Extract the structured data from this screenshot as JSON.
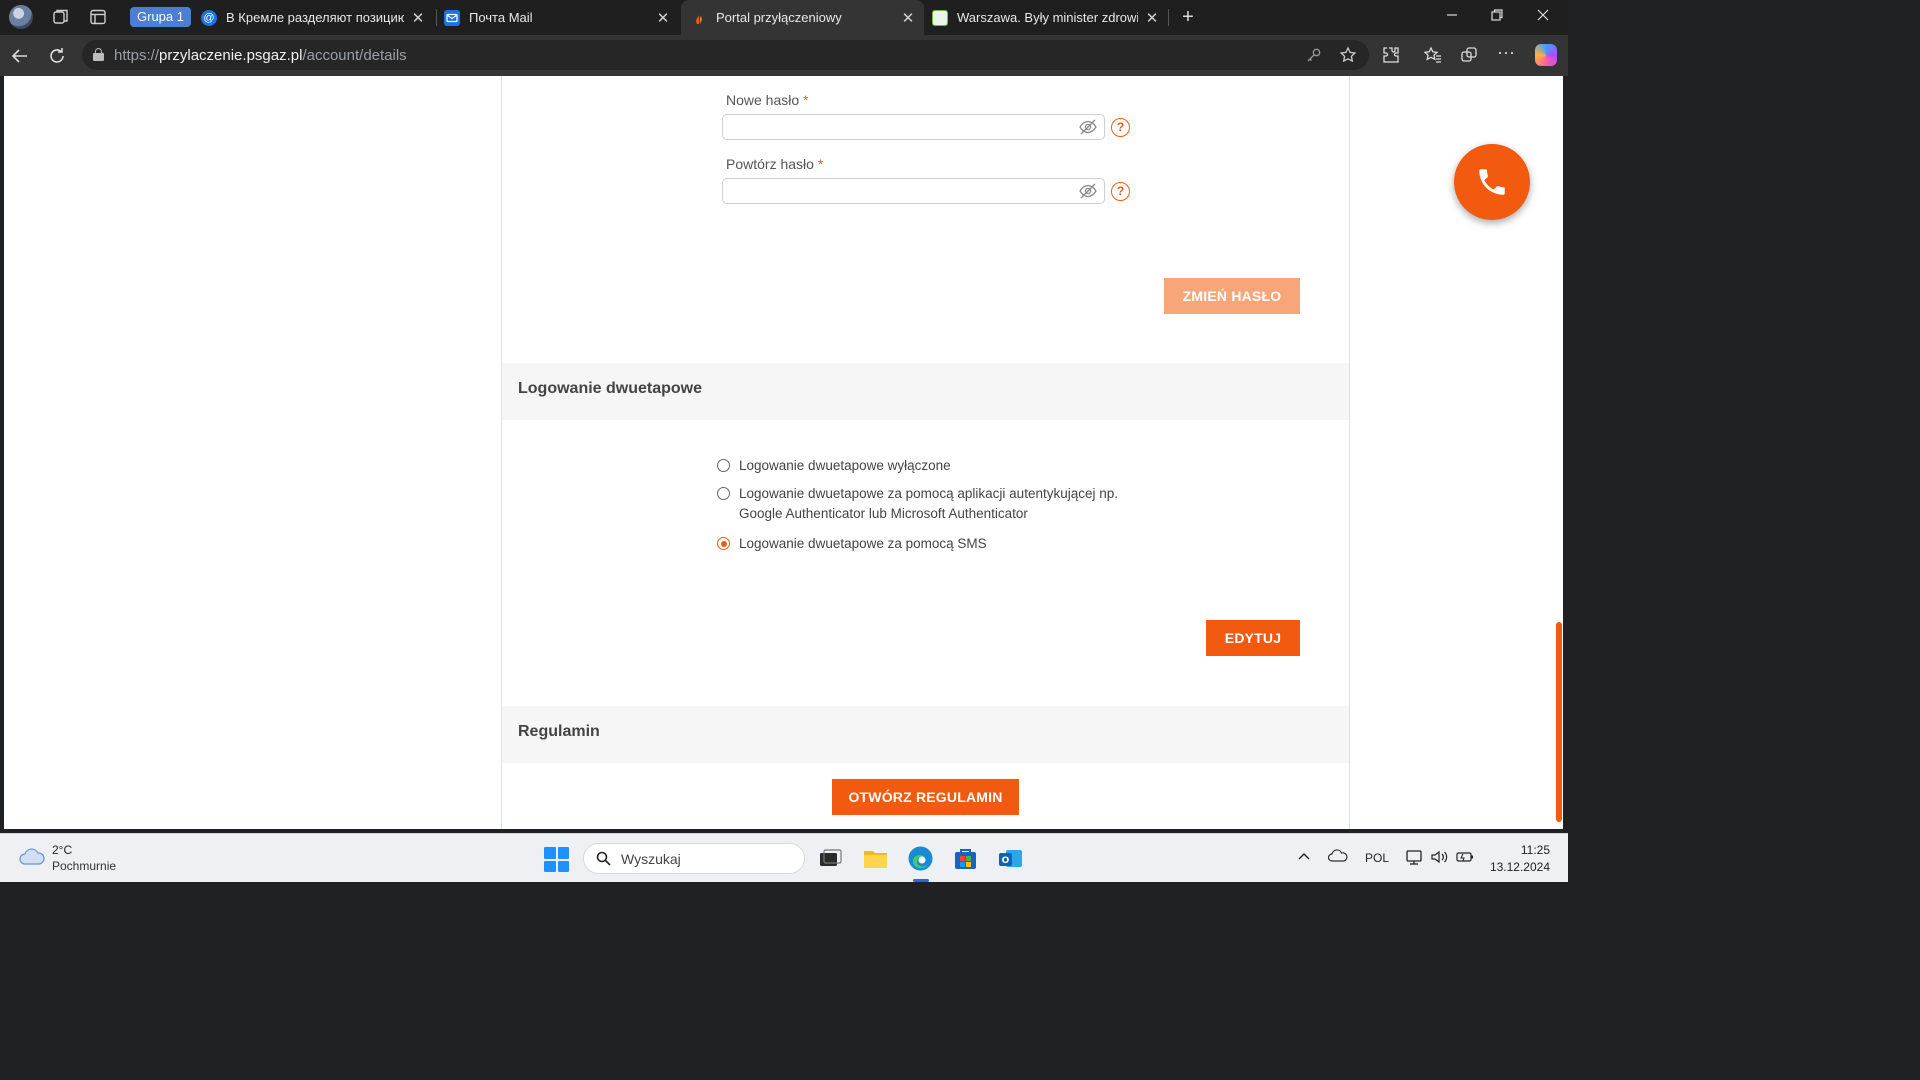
{
  "browser": {
    "group_label": "Grupa 1",
    "tabs": [
      {
        "title": "В Кремле разделяют позицию Т",
        "favicon_color": "#1a73e8",
        "active": false
      },
      {
        "title": "Почта Mail",
        "favicon_color": "#1a73e8",
        "active": false
      },
      {
        "title": "Portal przyłączeniowy",
        "favicon_color": "#f05a14",
        "active": true
      },
      {
        "title": "Warszawa. Były minister zdrowia s",
        "favicon_color": "#7cb342",
        "active": false
      }
    ],
    "close_glyph": "✕",
    "new_tab_glyph": "+",
    "url_prefix": "https://",
    "url_host": "przylaczenie.psgaz.pl",
    "url_path": "/account/details"
  },
  "password_form": {
    "new_password_label": "Nowe hasło",
    "repeat_password_label": "Powtórz hasło",
    "required_marker": "*",
    "new_password_value": "",
    "repeat_password_value": "",
    "help_glyph": "?",
    "change_button": "ZMIEŃ HASŁO"
  },
  "two_factor": {
    "title": "Logowanie dwuetapowe",
    "options": [
      {
        "line1": "Logowanie dwuetapowe wyłączone",
        "line2": "",
        "selected": false
      },
      {
        "line1": "Logowanie dwuetapowe za pomocą aplikacji autentykującej np.",
        "line2": "Google Authenticator lub Microsoft Authenticator",
        "selected": false
      },
      {
        "line1": "Logowanie dwuetapowe za pomocą SMS",
        "line2": "",
        "selected": true
      }
    ],
    "edit_button": "EDYTUJ"
  },
  "terms": {
    "title": "Regulamin",
    "open_button": "OTWÓRZ REGULAMIN"
  },
  "colors": {
    "accent": "#f15a0f",
    "accent_light": "#f8a57a",
    "section_bg": "#f6f6f6"
  },
  "taskbar": {
    "weather_temp": "2°C",
    "weather_desc": "Pochmurnie",
    "search_placeholder": "Wyszukaj",
    "language": "POL",
    "time": "11:25",
    "date": "13.12.2024"
  }
}
